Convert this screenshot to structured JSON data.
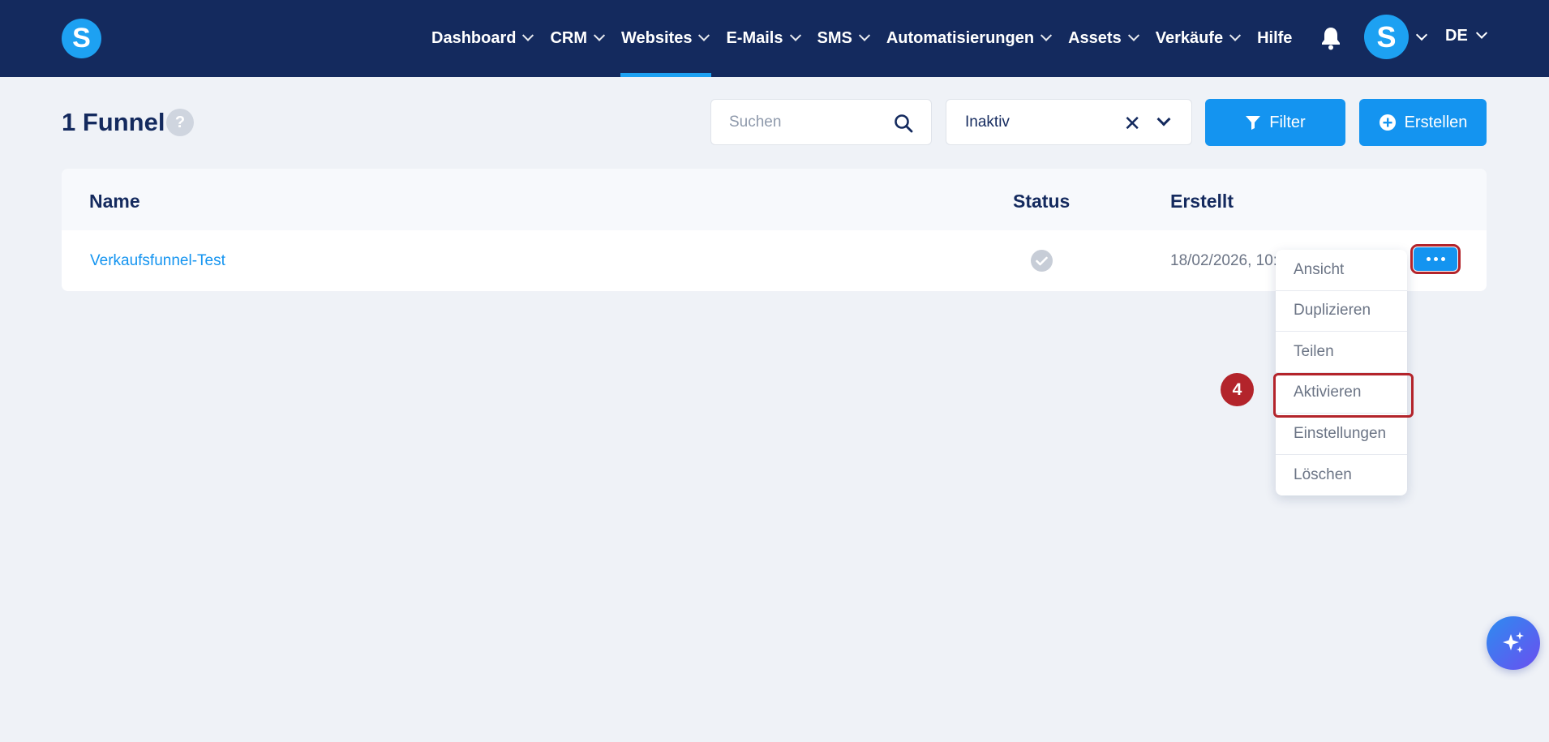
{
  "brand": {
    "logo_letter": "S"
  },
  "nav": {
    "items": [
      {
        "label": "Dashboard",
        "has_dropdown": true,
        "active": false
      },
      {
        "label": "CRM",
        "has_dropdown": true,
        "active": false
      },
      {
        "label": "Websites",
        "has_dropdown": true,
        "active": true
      },
      {
        "label": "E-Mails",
        "has_dropdown": true,
        "active": false
      },
      {
        "label": "SMS",
        "has_dropdown": true,
        "active": false
      },
      {
        "label": "Automatisierungen",
        "has_dropdown": true,
        "active": false
      },
      {
        "label": "Assets",
        "has_dropdown": true,
        "active": false
      },
      {
        "label": "Verkäufe",
        "has_dropdown": true,
        "active": false
      },
      {
        "label": "Hilfe",
        "has_dropdown": false,
        "active": false
      }
    ],
    "bell_icon": "bell-icon",
    "avatar_letter": "S",
    "language": "DE"
  },
  "page": {
    "title": "1 Funnel",
    "help_icon": "?"
  },
  "toolbar": {
    "search_placeholder": "Suchen",
    "search_value": "",
    "status_select_value": "Inaktiv",
    "filter_label": "Filter",
    "create_label": "Erstellen"
  },
  "table": {
    "columns": [
      "Name",
      "Status",
      "Erstellt"
    ],
    "rows": [
      {
        "name": "Verkaufsfunnel-Test",
        "status": "check-icon",
        "created": "18/02/2026, 10:"
      }
    ]
  },
  "row_menu": {
    "items": [
      "Ansicht",
      "Duplizieren",
      "Teilen",
      "Aktivieren",
      "Einstellungen",
      "Löschen"
    ],
    "highlighted": "Aktivieren"
  },
  "annotation": {
    "step_number": "4"
  },
  "colors": {
    "navbar": "#142a5e",
    "accent": "#1494f0",
    "highlight": "#b3242b",
    "background": "#eff2f7"
  }
}
